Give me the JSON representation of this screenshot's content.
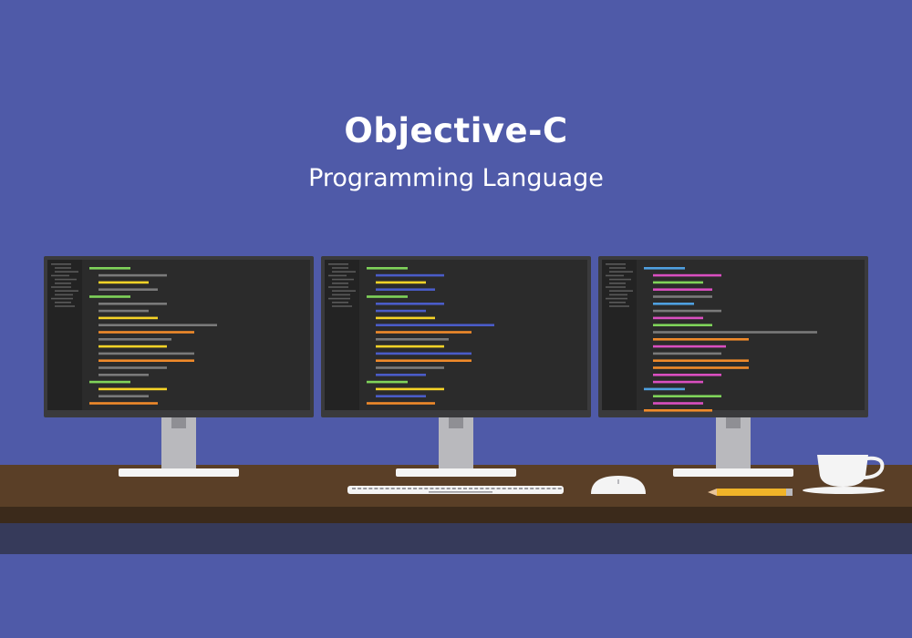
{
  "heading": {
    "title": "Objective-C",
    "subtitle": "Programming Language"
  },
  "colors": {
    "background": "#4f5aa8",
    "desk_top": "#5a3f27",
    "desk_edge": "#3b2a1b",
    "floor_band": "#363a5a",
    "monitor_frame": "#3a3a3c",
    "screen": "#2b2b2b",
    "sidebar": "#232323",
    "stand": "#b9b9bd",
    "white": "#f4f4f4",
    "pencil": "#f0b429"
  },
  "icons": [
    "monitor-icon",
    "keyboard-icon",
    "mouse-icon",
    "pencil-icon",
    "coffee-cup-icon"
  ],
  "monitors": [
    {
      "lines": [
        [
          "#7fd35a",
          0,
          45
        ],
        [
          "#7a7a7a",
          10,
          75
        ],
        [
          "#f5d327",
          10,
          55
        ],
        [
          "#7a7a7a",
          10,
          65
        ],
        [
          "#7fd35a",
          0,
          45
        ],
        [
          "#7a7a7a",
          10,
          75
        ],
        [
          "#7a7a7a",
          10,
          55
        ],
        [
          "#f5d327",
          10,
          65
        ],
        [
          "#7a7a7a",
          10,
          130
        ],
        [
          "#f08a2a",
          10,
          105
        ],
        [
          "#7a7a7a",
          10,
          80
        ],
        [
          "#f5d327",
          10,
          75
        ],
        [
          "#7a7a7a",
          10,
          105
        ],
        [
          "#f08a2a",
          10,
          105
        ],
        [
          "#7a7a7a",
          10,
          75
        ],
        [
          "#7a7a7a",
          10,
          55
        ],
        [
          "#7fd35a",
          0,
          45
        ],
        [
          "#f5d327",
          10,
          75
        ],
        [
          "#7a7a7a",
          10,
          55
        ],
        [
          "#f08a2a",
          0,
          75
        ]
      ]
    },
    {
      "lines": [
        [
          "#7fd35a",
          0,
          45
        ],
        [
          "#4a5cc8",
          10,
          75
        ],
        [
          "#f5d327",
          10,
          55
        ],
        [
          "#4a5cc8",
          10,
          65
        ],
        [
          "#7fd35a",
          0,
          45
        ],
        [
          "#4a5cc8",
          10,
          75
        ],
        [
          "#4a5cc8",
          10,
          55
        ],
        [
          "#f5d327",
          10,
          65
        ],
        [
          "#4a5cc8",
          10,
          130
        ],
        [
          "#f08a2a",
          10,
          105
        ],
        [
          "#7a7a7a",
          10,
          80
        ],
        [
          "#f5d327",
          10,
          75
        ],
        [
          "#4a5cc8",
          10,
          105
        ],
        [
          "#f08a2a",
          10,
          105
        ],
        [
          "#7a7a7a",
          10,
          75
        ],
        [
          "#4a5cc8",
          10,
          55
        ],
        [
          "#7fd35a",
          0,
          45
        ],
        [
          "#f5d327",
          10,
          75
        ],
        [
          "#4a5cc8",
          10,
          55
        ],
        [
          "#f08a2a",
          0,
          75
        ]
      ]
    },
    {
      "lines": [
        [
          "#4fa0e0",
          0,
          45
        ],
        [
          "#d94fc0",
          10,
          75
        ],
        [
          "#7fd35a",
          10,
          55
        ],
        [
          "#d94fc0",
          10,
          65
        ],
        [
          "#7a7a7a",
          10,
          65
        ],
        [
          "#4fa0e0",
          10,
          45
        ],
        [
          "#7a7a7a",
          10,
          75
        ],
        [
          "#d94fc0",
          10,
          55
        ],
        [
          "#7fd35a",
          10,
          65
        ],
        [
          "#7a7a7a",
          10,
          180
        ],
        [
          "#f08a2a",
          10,
          105
        ],
        [
          "#d94fc0",
          10,
          80
        ],
        [
          "#7a7a7a",
          10,
          75
        ],
        [
          "#f08a2a",
          10,
          105
        ],
        [
          "#f08a2a",
          10,
          105
        ],
        [
          "#d94fc0",
          10,
          75
        ],
        [
          "#d94fc0",
          10,
          55
        ],
        [
          "#4fa0e0",
          0,
          45
        ],
        [
          "#7fd35a",
          10,
          75
        ],
        [
          "#d94fc0",
          10,
          55
        ],
        [
          "#f08a2a",
          0,
          75
        ]
      ]
    }
  ]
}
